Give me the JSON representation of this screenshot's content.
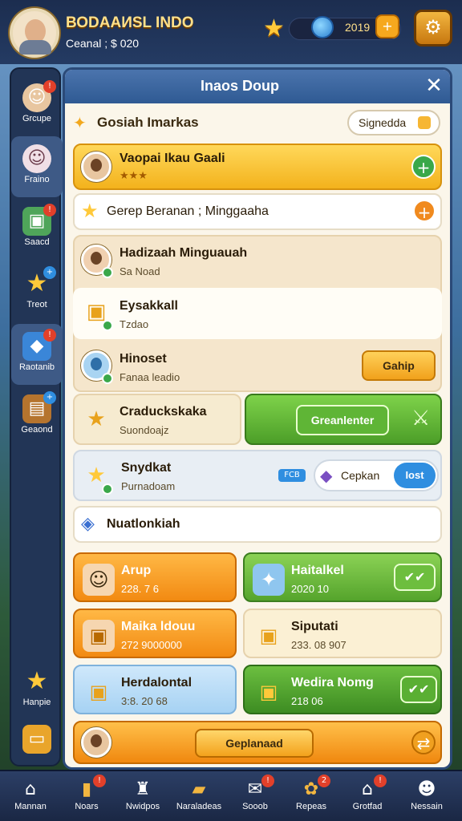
{
  "header": {
    "player_name": "ВОDAAИSL INDO",
    "player_sub": "Ceanal ; $ 020",
    "resource_value": "2019"
  },
  "rail": [
    {
      "label": "Grcupe",
      "icon": "user-icon",
      "badge": "!"
    },
    {
      "label": "Fraino",
      "icon": "user-icon",
      "badge": ""
    },
    {
      "label": "Saacd",
      "icon": "box-icon",
      "badge": "!"
    },
    {
      "label": "Treot",
      "icon": "star-icon",
      "badge": "+"
    },
    {
      "label": "Raotanib",
      "icon": "cube-icon",
      "badge": "!"
    },
    {
      "label": "Geaond",
      "icon": "chest-icon",
      "badge": "+"
    },
    {
      "label": "Hanpie",
      "icon": "star-icon",
      "badge": ""
    },
    {
      "label": "",
      "icon": "card-icon",
      "badge": ""
    }
  ],
  "panel": {
    "title": "Inaos Doup",
    "section_title": "Gosiah Imarkas",
    "filter_chip": "Signedda",
    "featured": {
      "name": "Vaopai Ikau Gaali",
      "stars": "★★★"
    },
    "banner": "Gerep Beranan ; Minggaaha",
    "members": [
      {
        "name": "Hadizaah Minguauah",
        "sub": "Sa Noad"
      },
      {
        "name": "Eysakkall",
        "sub": "Tzdao"
      },
      {
        "name": "Hinoset",
        "sub": "Fanaa leadio",
        "button": "Gahip"
      }
    ],
    "card_left": {
      "name": "Craduckskaka",
      "sub": "Suondoajz"
    },
    "card_right_button": "Greanlenter",
    "snydkat": {
      "name": "Snydkat",
      "sub": "Purnadoam",
      "tag": "FCB",
      "cepkan": "Cepkan",
      "cepkan_btn": "Iost"
    },
    "section2": "Nuatlonkiah",
    "tiles": [
      {
        "name": "Arup",
        "sub": "228. 7 6"
      },
      {
        "name": "Haitalkel",
        "sub": "2020 10"
      },
      {
        "name": "Maika ldouu",
        "sub": "272 9000000"
      },
      {
        "name": "Siputati",
        "sub": "233. 08 907"
      },
      {
        "name": "Herdalontal",
        "sub": "3:8. 20 68"
      },
      {
        "name": "Wedira Nomg",
        "sub": "218 06"
      }
    ],
    "bottom_button": "Geplanaad"
  },
  "bottom_nav": [
    {
      "label": "Mannan",
      "icon": "home-icon",
      "badge": ""
    },
    {
      "label": "Noars",
      "icon": "card-icon",
      "badge": "!"
    },
    {
      "label": "Nwidpos",
      "icon": "helmet-icon",
      "badge": ""
    },
    {
      "label": "Naraladeas",
      "icon": "map-icon",
      "badge": ""
    },
    {
      "label": "Sooob",
      "icon": "inbox-icon",
      "badge": "!"
    },
    {
      "label": "Repeas",
      "icon": "gift-icon",
      "badge": "2"
    },
    {
      "label": "Grotfad",
      "icon": "shop-icon",
      "badge": "!"
    },
    {
      "label": "Nessain",
      "icon": "profile-icon",
      "badge": ""
    }
  ]
}
